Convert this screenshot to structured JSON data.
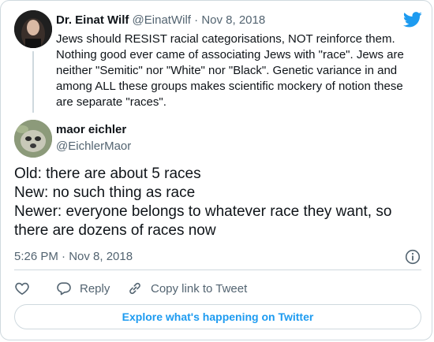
{
  "parent_tweet": {
    "name": "Dr. Einat Wilf",
    "handle": "@EinatWilf",
    "separator": "·",
    "date": "Nov 8, 2018",
    "text": "Jews should RESIST racial categorisations, NOT reinforce them. Nothing good ever came of associating Jews with \"race\". Jews are neither \"Semitic\" nor \"White\" nor \"Black\". Genetic variance in and among ALL these groups makes scientific mockery of notion these are separate \"races\"."
  },
  "main_tweet": {
    "name": "maor eichler",
    "handle": "@EichlerMaor",
    "lines": [
      "Old: there are about 5 races",
      "New: no such thing as race",
      "Newer: everyone belongs to whatever race they want, so",
      "there are dozens of races now"
    ],
    "timestamp": "5:26 PM · Nov 8, 2018"
  },
  "actions": {
    "reply_label": "Reply",
    "copy_link_label": "Copy link to Tweet"
  },
  "explore_label": "Explore what's happening on Twitter",
  "colors": {
    "accent": "#1d9bf0",
    "text": "#0f1419",
    "muted": "#536471",
    "border": "#cfd9de"
  },
  "icons": [
    "twitter-logo-icon",
    "info-icon",
    "heart-icon",
    "reply-icon",
    "link-icon"
  ]
}
